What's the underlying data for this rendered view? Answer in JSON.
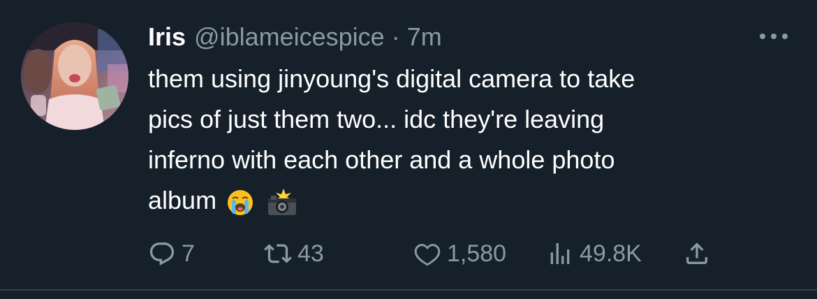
{
  "tweet": {
    "display_name": "Iris",
    "handle": "@iblameicespice",
    "separator": "·",
    "time": "7m",
    "text": "them using jinyoung's digital camera to take\npics of just them two... idc they're leaving\ninferno with each other and a whole photo\nalbum",
    "emojis": [
      "crying-face-emoji",
      "camera-with-flash-emoji"
    ],
    "avatar_icon": "profile-avatar"
  },
  "actions": {
    "reply_count": "7",
    "retweet_count": "43",
    "like_count": "1,580",
    "view_count": "49.8K"
  },
  "colors": {
    "background": "#15202b",
    "muted_text": "#8b98a5",
    "primary_text": "#ffffff",
    "divider": "#38444d"
  }
}
